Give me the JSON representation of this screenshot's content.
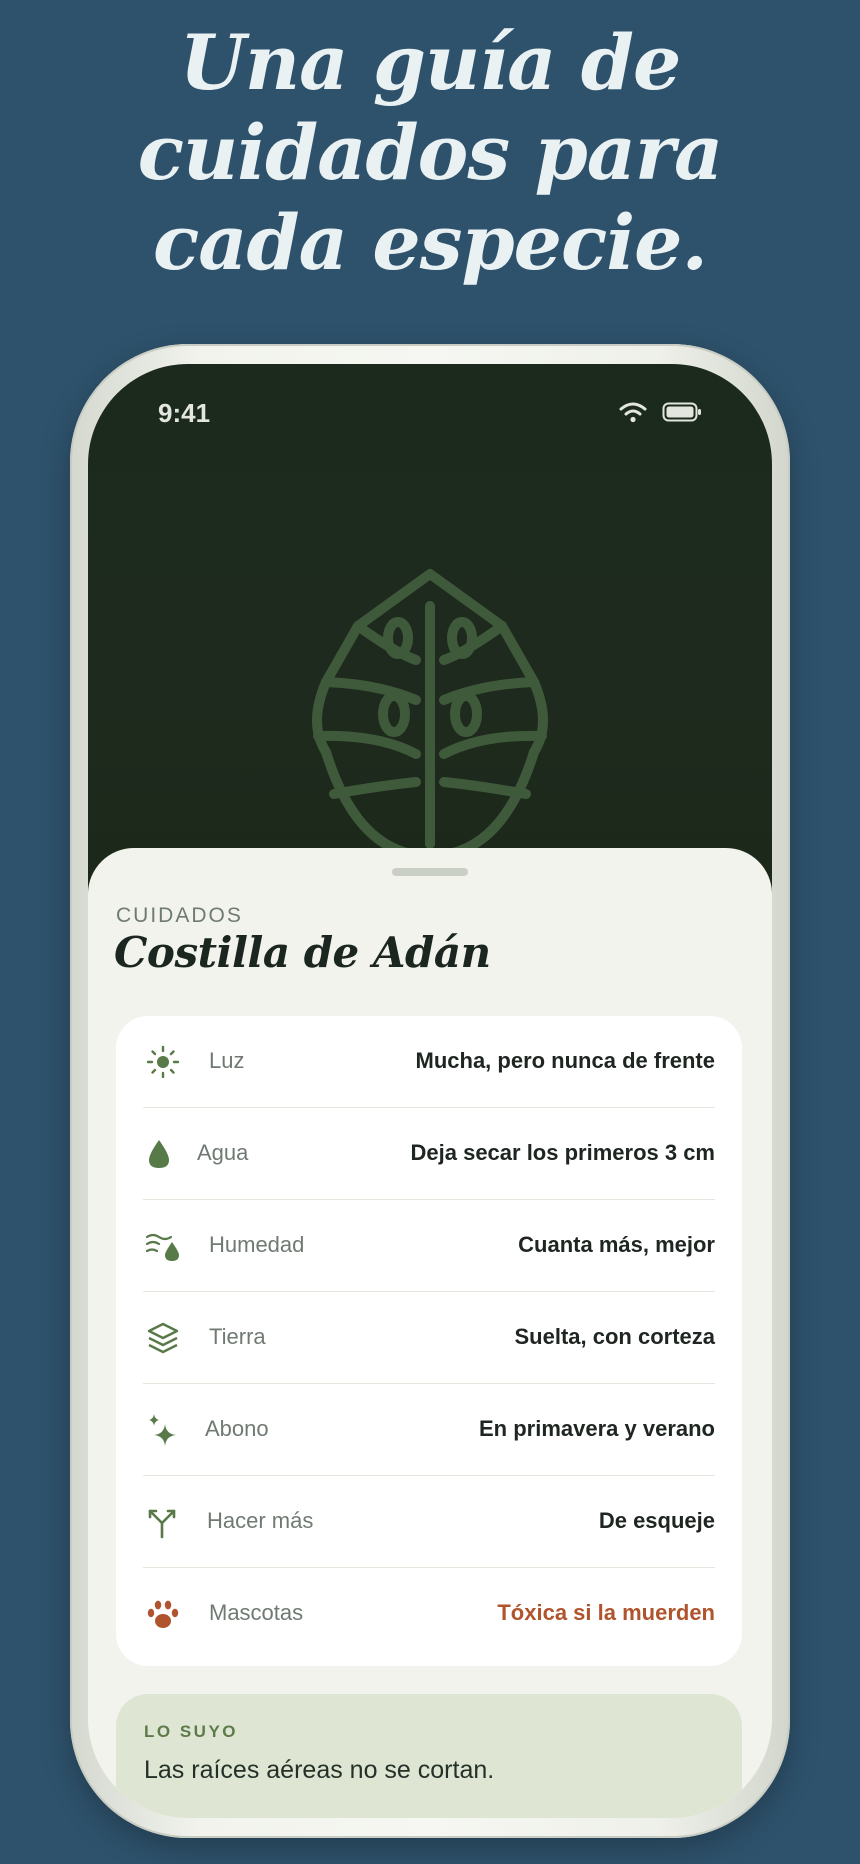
{
  "headline": {
    "line1": "Una guía de",
    "line2": "cuidados para",
    "line3": "cada especie."
  },
  "status_bar": {
    "time": "9:41",
    "icons": [
      "wifi-icon",
      "battery-icon"
    ]
  },
  "hero": {
    "illustration": "monstera-leaf-icon"
  },
  "sheet": {
    "eyebrow": "CUIDADOS",
    "title": "Costilla de Adán",
    "care_rows": [
      {
        "icon": "sun-icon",
        "label": "Luz",
        "value": "Mucha, pero nunca de frente"
      },
      {
        "icon": "water-drop-icon",
        "label": "Agua",
        "value": "Deja secar los primeros 3 cm"
      },
      {
        "icon": "humidity-icon",
        "label": "Humedad",
        "value": "Cuanta más, mejor"
      },
      {
        "icon": "soil-layers-icon",
        "label": "Tierra",
        "value": "Suelta, con corteza"
      },
      {
        "icon": "fertilizer-sparkle-icon",
        "label": "Abono",
        "value": "En primavera y verano"
      },
      {
        "icon": "propagation-branch-icon",
        "label": "Hacer más",
        "value": "De esqueje"
      },
      {
        "icon": "paw-icon",
        "label": "Mascotas",
        "value": "Tóxica si la muerden"
      }
    ],
    "tip": {
      "eyebrow": "LO SUYO",
      "text": "Las raíces aéreas no se cortan."
    }
  },
  "colors": {
    "background": "#2e526c",
    "headline": "#e9f1f3",
    "hero": "#1c2a1e",
    "accent_green": "#587a48",
    "warning": "#b0542e",
    "tip_background": "#dee6d3"
  }
}
